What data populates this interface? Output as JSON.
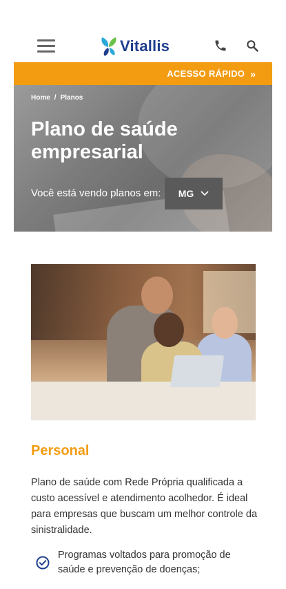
{
  "header": {
    "logo_text": "Vitallis",
    "menu_icon": "hamburger-menu-icon",
    "phone_icon": "phone-icon",
    "search_icon": "search-icon"
  },
  "quick_access": {
    "label": "ACESSO RÁPIDO",
    "arrow": "»"
  },
  "hero": {
    "breadcrumb": [
      "Home",
      "/",
      "Planos"
    ],
    "title": "Plano de saúde empresarial",
    "location_label": "Você está vendo planos em:",
    "state_value": "MG"
  },
  "plan": {
    "title": "Personal",
    "description": "Plano de saúde com Rede Própria qualificada a custo acessível e atendimento acolhedor. É ideal para empresas que buscam um melhor controle da sinistralidade.",
    "features": [
      "Programas voltados para promoção de saúde e prevenção de doenças;"
    ]
  },
  "colors": {
    "accent": "#f39c12",
    "brand_blue": "#1e3e8e",
    "select_bg": "#5a5a5a"
  }
}
